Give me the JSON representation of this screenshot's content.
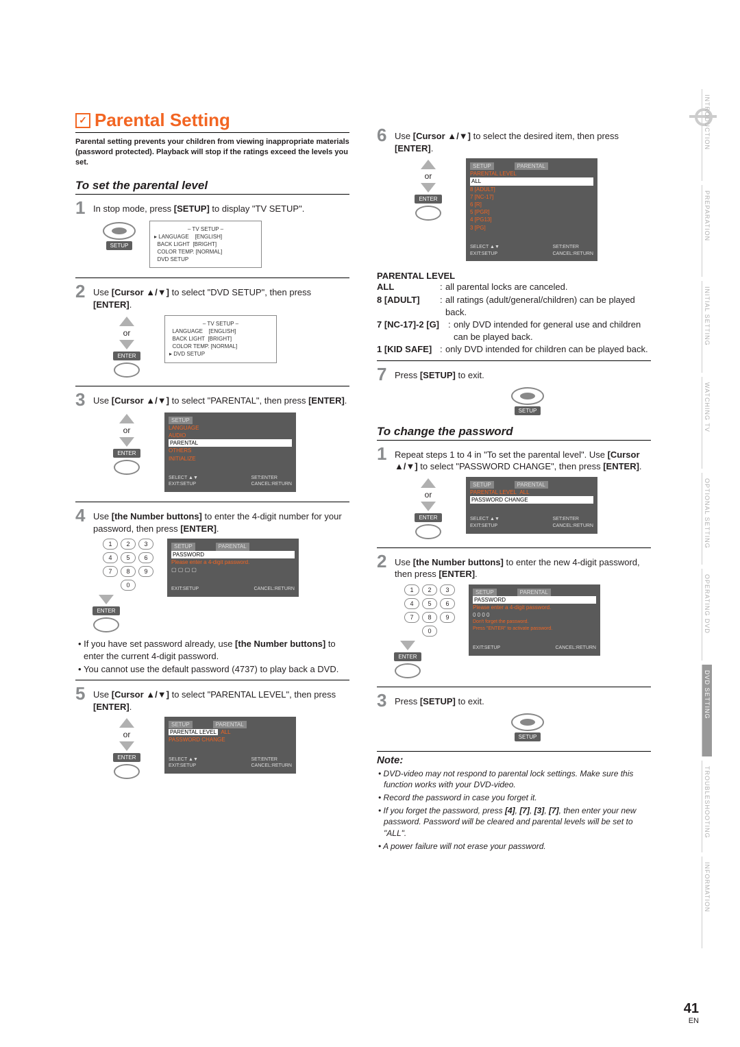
{
  "title": "Parental Setting",
  "intro": "Parental setting prevents your children from viewing inappropriate materials (password protected). Playback will stop if the ratings exceed the levels you set.",
  "section_a": "To set the parental level",
  "section_b": "To change the password",
  "steps_a": {
    "s1": "In stop mode, press [SETUP] to display \"TV SETUP\".",
    "s2": "Use [Cursor ▲/▼] to select \"DVD SETUP\", then press [ENTER].",
    "s3": "Use [Cursor ▲/▼] to select \"PARENTAL\", then press [ENTER].",
    "s4": "Use [the Number buttons] to enter the 4-digit number for your password, then press [ENTER].",
    "s4_b1": "If you have set password already, use [the Number buttons] to enter the current 4-digit password.",
    "s4_b2": "You cannot use the default password (4737) to play back a DVD.",
    "s5": "Use [Cursor ▲/▼] to select \"PARENTAL LEVEL\", then press [ENTER].",
    "s6": "Use [Cursor ▲/▼] to select the desired item, then press [ENTER].",
    "s7": "Press [SETUP] to exit."
  },
  "parental_level_heading": "PARENTAL LEVEL",
  "parental_defs": {
    "k1": "ALL",
    "v1": "all parental locks are canceled.",
    "k2": "8 [ADULT]",
    "v2": "all ratings (adult/general/children) can be played back.",
    "k3": "7 [NC-17]-2 [G]",
    "v3": "only DVD intended for general use and children can be played back.",
    "k4": "1 [KID SAFE]",
    "v4": "only DVD intended for children can be played back."
  },
  "steps_b": {
    "s1": "Repeat steps 1 to 4 in \"To set the parental level\". Use [Cursor ▲/▼] to select \"PASSWORD CHANGE\", then press [ENTER].",
    "s2": "Use [the Number buttons] to enter the new 4-digit password, then press [ENTER].",
    "s3": "Press [SETUP] to exit."
  },
  "note_title": "Note:",
  "notes": {
    "n1": "DVD-video may not respond to parental lock settings. Make sure this function works with your DVD-video.",
    "n2": "Record the password in case you forget it.",
    "n3": "If you forget the password, press [4], [7], [3], [7], then enter your new password. Password will be cleared and parental levels will be set to \"ALL\".",
    "n4": "A power failure will not erase your password."
  },
  "labels": {
    "or": "or",
    "enter": "ENTER",
    "setup": "SETUP"
  },
  "osd": {
    "tv_title": "– TV SETUP –",
    "tv_rows": [
      [
        "LANGUAGE",
        "[ENGLISH]"
      ],
      [
        "BACK LIGHT",
        "[BRIGHT]"
      ],
      [
        "COLOR TEMP.",
        "[NORMAL]"
      ],
      [
        "DVD SETUP",
        ""
      ]
    ],
    "setup_hdr": "SETUP",
    "parental_hdr": "PARENTAL",
    "menu3": [
      "LANGUAGE",
      "AUDIO",
      "PARENTAL",
      "OTHERS",
      "INITIALIZE"
    ],
    "pwd_prompt": "Please enter a 4-digit password.",
    "pwd_note1": "Don't forget the password.",
    "pwd_note2": "Press \"ENTER\" to activate password.",
    "ft_l": "SELECT ▲▼",
    "ft_r": "SET:ENTER",
    "ft_l2": "EXIT:SETUP",
    "ft_r2": "CANCEL:RETURN",
    "pl_row": "PARENTAL LEVEL",
    "pl_val": "ALL",
    "pc_row": "PASSWORD CHANGE",
    "levels": [
      "ALL",
      "8 [ADULT]",
      "7 [NC-17]",
      "6 [R]",
      "5 [PGR]",
      "4 [PG13]",
      "3 [PG]"
    ]
  },
  "tabs": [
    "INTRODUCTION",
    "PREPARATION",
    "INITIAL SETTING",
    "WATCHING TV",
    "OPTIONAL SETTING",
    "OPERATING DVD",
    "DVD SETTING",
    "TROUBLESHOOTING",
    "INFORMATION"
  ],
  "page": {
    "num": "41",
    "lang": "EN"
  }
}
